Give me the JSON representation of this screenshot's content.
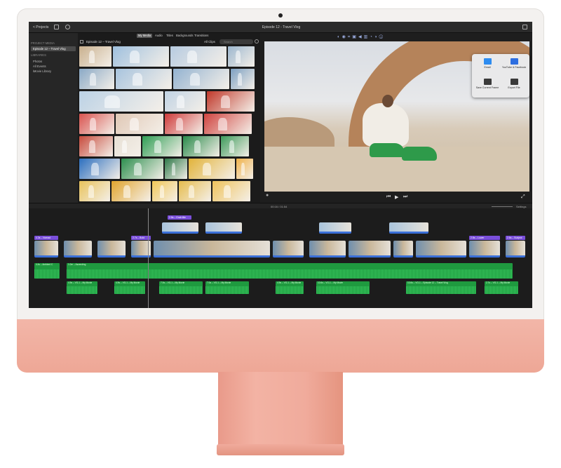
{
  "window": {
    "title": "Episode 12 - Travel Vlog",
    "back_label": "< Projects"
  },
  "sidebar": {
    "project_media_header": "PROJECT MEDIA",
    "project_item": "Episode 12 – Travel Vlog",
    "libraries_header": "LIBRARIES",
    "items": [
      "Photos",
      "All Events",
      "iMovie Library"
    ]
  },
  "browser": {
    "tabs": [
      "My Media",
      "Audio",
      "Titles",
      "Backgrounds",
      "Transitions"
    ],
    "selected_tab": "My Media",
    "heading": "Episode 12 – Travel Vlog",
    "filter": "All Clips",
    "search_placeholder": "Search"
  },
  "share": {
    "items": [
      "Email",
      "YouTube & Facebook",
      "Save Current Frame",
      "Export File"
    ]
  },
  "timeline": {
    "timecode": "00:16 / 01:54",
    "settings_label": "Settings",
    "titles": [
      "2.8s – Grab title"
    ],
    "clip_labels": [
      "4.3s – Nomad",
      "2.7s – Bold",
      "2.8s – Lower",
      "2.6s – Subject"
    ],
    "audio_labels": [
      "4.4s – Ambient C",
      "1.0m – Ascending",
      "4.9s – VO-1 – My Movie",
      "4.9s – VO-1 – My Movie",
      "7.0s – VO-1 – My Movie",
      "7.0s – VO-1 – My Movie",
      "4.9s – VO-1 – My Movie",
      "10.6s – VO-1 – My Movie",
      "10.6s – VO-1 – Episode 12 – Travel Vlog",
      "2.7s – VO-1 – My Movie"
    ]
  },
  "colors": {
    "accent": "#3a6fd8",
    "audio_green": "#1f9a3f",
    "chin_pink": "#eea796",
    "title_purple": "#7a4fdb"
  }
}
